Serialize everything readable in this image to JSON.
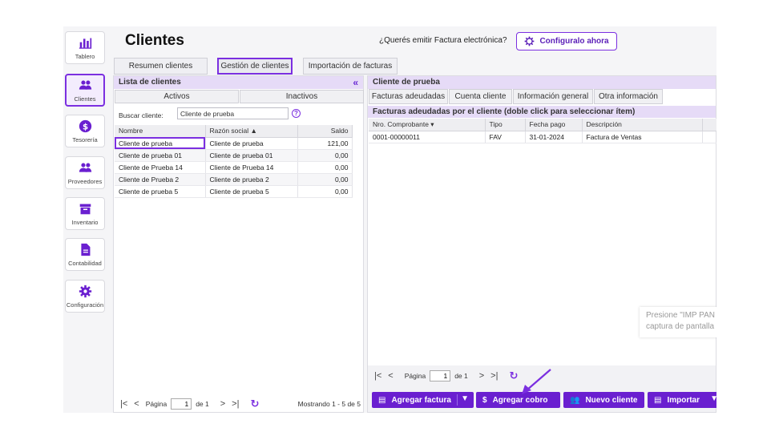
{
  "header": {
    "title": "Clientes",
    "cta_text": "¿Querés emitir Factura electrónica?",
    "cta_button": "Configuralo ahora"
  },
  "sidebar": {
    "items": [
      {
        "label": "Tablero",
        "icon": "bar-chart-icon"
      },
      {
        "label": "Clientes",
        "icon": "users-icon",
        "active": true
      },
      {
        "label": "Tesorería",
        "icon": "dollar-circle-icon"
      },
      {
        "label": "Proveedores",
        "icon": "users-icon"
      },
      {
        "label": "Inventario",
        "icon": "archive-box-icon"
      },
      {
        "label": "Contabilidad",
        "icon": "document-icon"
      },
      {
        "label": "Configuración",
        "icon": "gear-icon"
      }
    ]
  },
  "tabs": [
    "Resumen clientes",
    "Gestión de clientes",
    "Importación de facturas"
  ],
  "active_tab": "Gestión de clientes",
  "left": {
    "title": "Lista de clientes",
    "subtabs": [
      "Activos",
      "Inactivos"
    ],
    "search_label": "Buscar cliente:",
    "search_value": "Cliente de prueba",
    "columns": [
      "Nombre",
      "Razón social ▲",
      "Saldo"
    ],
    "rows": [
      [
        "Cliente de prueba",
        "Cliente de prueba",
        "121,00"
      ],
      [
        "Cliente de prueba 01",
        "Cliente de prueba 01",
        "0,00"
      ],
      [
        "Cliente de Prueba 14",
        "Cliente de Prueba 14",
        "0,00"
      ],
      [
        "Cliente de Prueba 2",
        "Cliente de prueba 2",
        "0,00"
      ],
      [
        "Cliente de prueba 5",
        "Cliente de prueba 5",
        "0,00"
      ]
    ],
    "pager": {
      "page_label": "Página",
      "page": "1",
      "of": "de 1",
      "showing": "Mostrando 1 - 5 de 5"
    }
  },
  "right": {
    "title": "Cliente de prueba",
    "tabs": [
      "Facturas adeudadas",
      "Cuenta cliente",
      "Información general",
      "Otra información"
    ],
    "section": "Facturas adeudadas por el cliente (doble click para seleccionar ítem)",
    "columns": [
      "Nro. Comprobante ▾",
      "Tipo",
      "Fecha pago",
      "Descripción"
    ],
    "rows": [
      [
        "0001-00000011",
        "FAV",
        "31-01-2024",
        "Factura de Ventas"
      ]
    ],
    "pager": {
      "page_label": "Página",
      "page": "1",
      "of": "de 1"
    },
    "actions": [
      "Agregar factura",
      "Agregar cobro",
      "Nuevo cliente",
      "Importar"
    ]
  },
  "tooltip": {
    "line1": "Presione \"IMP PAN",
    "line2": "captura de pantalla"
  },
  "colors": {
    "accent": "#7b2fe0",
    "button": "#6a1fd0",
    "header_band": "#e6dbf7"
  }
}
